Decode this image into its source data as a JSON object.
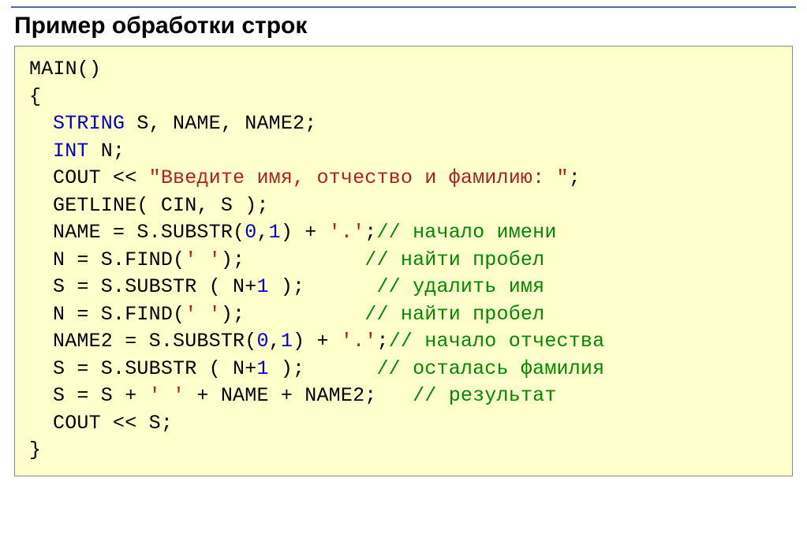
{
  "title": "Пример обработки строк",
  "code": {
    "l1": "MAIN()",
    "l2": "{",
    "l3_kw": "STRING",
    "l3_rest": " S, NAME, NAME2;",
    "l4_kw": "INT",
    "l4_rest": " N;",
    "l5_a": "COUT << ",
    "l5_str": "\"Введите имя, отчество и фамилию: \"",
    "l5_b": ";",
    "l6": "GETLINE( CIN, S );",
    "l7_a": "NAME = S.SUBSTR(",
    "l7_n1": "0",
    "l7_c1": ",",
    "l7_n2": "1",
    "l7_b": ") + ",
    "l7_str": "'.'",
    "l7_c": ";",
    "l7_cm": "// начало имени",
    "l8_a": "N = S.FIND(",
    "l8_str": "' '",
    "l8_b": ");          ",
    "l8_cm": "// найти пробел",
    "l9_a": "S = S.SUBSTR ( N+",
    "l9_n": "1",
    "l9_b": " );      ",
    "l9_cm": "// удалить имя",
    "l10_a": "N = S.FIND(",
    "l10_str": "' '",
    "l10_b": ");          ",
    "l10_cm": "// найти пробел",
    "l11_a": "NAME2 = S.SUBSTR(",
    "l11_n1": "0",
    "l11_c1": ",",
    "l11_n2": "1",
    "l11_b": ") + ",
    "l11_str": "'.'",
    "l11_c": ";",
    "l11_cm": "// начало отчества",
    "l12_a": "S = S.SUBSTR ( N+",
    "l12_n": "1",
    "l12_b": " );      ",
    "l12_cm": "// осталась фамилия",
    "l13_a": "S = S + ",
    "l13_str": "' '",
    "l13_b": " + NAME + NAME2;   ",
    "l13_cm": "// результат",
    "l14": "COUT << S;",
    "l15": "}"
  }
}
